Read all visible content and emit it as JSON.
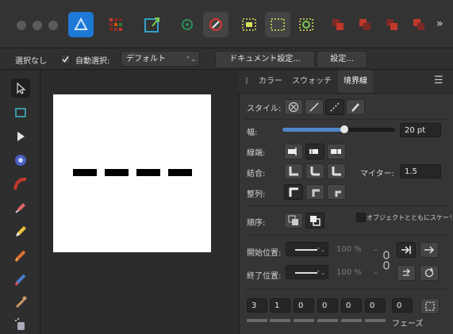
{
  "context_bar": {
    "selection": "選択なし",
    "auto_select_label": "自動選択:",
    "auto_select_value": "デフォルト",
    "doc_settings": "ドキュメント設定...",
    "settings": "設定..."
  },
  "panel": {
    "tabs": [
      "カラー",
      "スウォッチ",
      "境界線"
    ],
    "style_label": "スタイル:",
    "width_label": "幅:",
    "width_value": "20 pt",
    "width_fraction": 0.55,
    "cap_label": "線端:",
    "join_label": "結合:",
    "miter_label": "マイター:",
    "miter_value": "1.5",
    "align_label": "整列:",
    "order_label": "順序:",
    "scale_with_object": "オブジェクトとともにスケーリング",
    "start_label": "開始位置:",
    "end_label": "終了位置:",
    "start_scale": "100 %",
    "end_scale": "100 %",
    "dash_values": [
      "3",
      "1",
      "0",
      "0",
      "0",
      "0",
      "0"
    ],
    "phase_label": "フェーズ"
  },
  "colors": {
    "accent": "#1f8ef0",
    "window_bg": "#2b2b2b",
    "panel_bg": "#353535"
  }
}
